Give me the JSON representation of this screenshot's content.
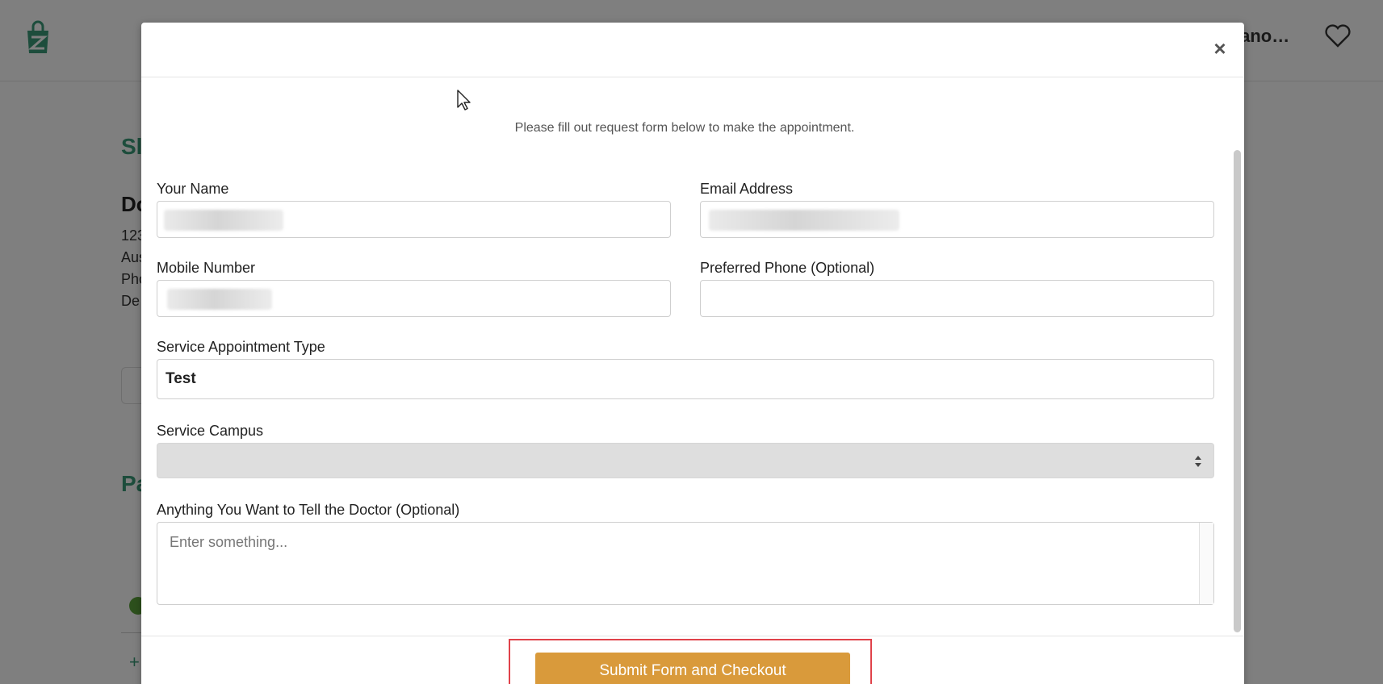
{
  "background": {
    "user_name": "iano…",
    "section_titles": [
      "Sl",
      "Pa"
    ],
    "doctor_name_fragment": "Do",
    "info_lines": [
      "123",
      "Aus",
      "Pho",
      "De"
    ],
    "plus": "+"
  },
  "modal": {
    "close_label": "×",
    "intro": "Please fill out request form below to make the appointment.",
    "fields": {
      "name_label": "Your Name",
      "email_label": "Email Address",
      "mobile_label": "Mobile Number",
      "preferred_phone_label": "Preferred Phone (Optional)",
      "appointment_type_label": "Service Appointment Type",
      "appointment_type_value": "Test",
      "campus_label": "Service Campus",
      "campus_value": "",
      "message_label": "Anything You Want to Tell the Doctor (Optional)",
      "message_placeholder": "Enter something..."
    },
    "submit_label": "Submit Form and Checkout"
  },
  "colors": {
    "accent_green": "#3a9a78",
    "button_gold": "#d99a3b",
    "highlight_red": "#e0424a"
  }
}
